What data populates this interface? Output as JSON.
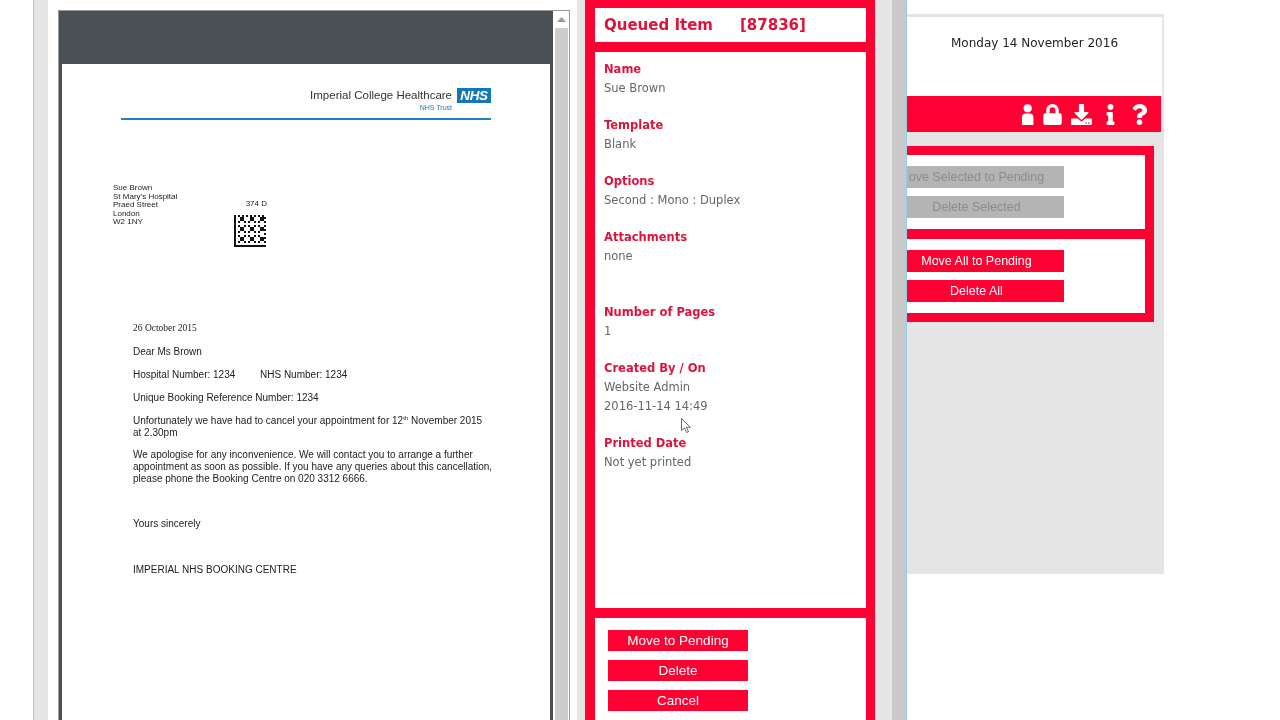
{
  "document_viewer": {
    "letter": {
      "logo": {
        "organisation": "Imperial College Healthcare",
        "badge": "NHS",
        "subtitle": "NHS Trust"
      },
      "address": [
        "Sue Brown",
        "St Mary’s Hospital",
        "Praed Street",
        "London",
        "W2 1NY"
      ],
      "code_label": "374 D",
      "date": "26 October 2015",
      "salutation": "Dear Ms Brown",
      "numbers": [
        "Hospital Number: 1234",
        "NHS Number: 1234"
      ],
      "reference": "Unique Booking Reference Number: 1234",
      "paragraphs": [
        [
          "Unfortunately we have had to cancel your appointment for 12$^{th}$ November 2015",
          "at 2.30pm"
        ],
        [
          "We apologise for any inconvenience. We will contact you to arrange a further",
          "appointment as soon as possible. If you have any queries about this cancellation,",
          "please phone the Booking Centre on 020 3312 6666."
        ]
      ],
      "closing": "Yours sincerely",
      "signature": "IMPERIAL NHS BOOKING CENTRE"
    }
  },
  "queued_item": {
    "title": "Queued Item",
    "id": "[87836]",
    "fields": [
      {
        "label": "Name",
        "values": [
          "Sue Brown"
        ]
      },
      {
        "label": "Template",
        "values": [
          "Blank"
        ]
      },
      {
        "label": "Options",
        "values": [
          "Second : Mono : Duplex"
        ]
      },
      {
        "label": "Attachments",
        "values": [
          "none"
        ]
      },
      {
        "label": "Number of Pages",
        "values": [
          "1"
        ]
      },
      {
        "label": "Created By / On",
        "values": [
          "Website Admin",
          "2016-11-14 14:49"
        ]
      },
      {
        "label": "Printed Date",
        "values": [
          "Not yet printed"
        ]
      }
    ],
    "buttons": [
      {
        "label": "Move to Pending"
      },
      {
        "label": "Delete"
      },
      {
        "label": "Cancel"
      }
    ]
  },
  "side_panel": {
    "date": "Monday 14 November 2016",
    "selected_actions": [
      {
        "label": "ove Selected to Pending",
        "disabled": true
      },
      {
        "label": "Delete Selected",
        "disabled": true
      }
    ],
    "all_actions": [
      {
        "label": "Move All to Pending",
        "disabled": false
      },
      {
        "label": "Delete All",
        "disabled": false
      }
    ]
  }
}
